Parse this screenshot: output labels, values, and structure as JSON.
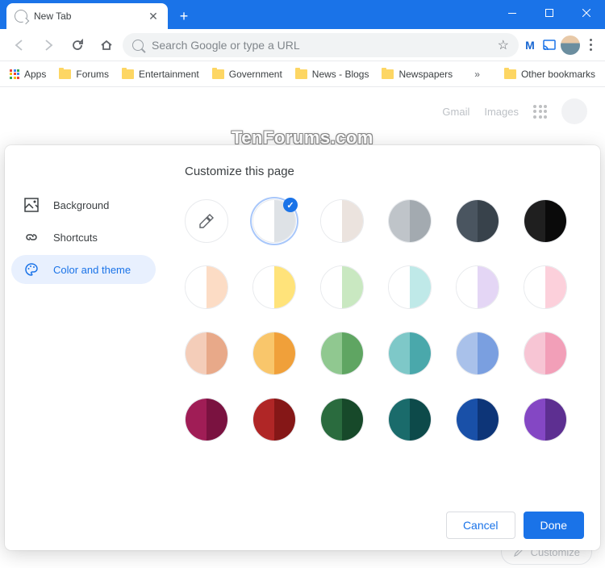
{
  "watermark": "TenForums.com",
  "tab": {
    "title": "New Tab"
  },
  "omnibox": {
    "placeholder": "Search Google or type a URL"
  },
  "bookmarks": {
    "apps": "Apps",
    "items": [
      "Forums",
      "Entertainment",
      "Government",
      "News - Blogs",
      "Newspapers"
    ],
    "overflow": "»",
    "other": "Other bookmarks"
  },
  "ntp": {
    "gmail": "Gmail",
    "images": "Images"
  },
  "dialog": {
    "title": "Customize this page",
    "sidebar": {
      "background": "Background",
      "shortcuts": "Shortcuts",
      "colortheme": "Color and theme"
    },
    "buttons": {
      "cancel": "Cancel",
      "done": "Done"
    }
  },
  "customize_btn": "Customize",
  "swatches": [
    {
      "type": "picker"
    },
    {
      "l": "#ffffff",
      "r": "#dee2e6",
      "selected": true
    },
    {
      "l": "#ffffff",
      "r": "#ebe3de"
    },
    {
      "l": "#bfc4c9",
      "r": "#a3aab0"
    },
    {
      "l": "#4a5560",
      "r": "#38424b"
    },
    {
      "l": "#1f1f1f",
      "r": "#0a0a0a"
    },
    {
      "l": "#ffffff",
      "r": "#fcdcc5"
    },
    {
      "l": "#ffffff",
      "r": "#ffe37a"
    },
    {
      "l": "#ffffff",
      "r": "#c9e8c1"
    },
    {
      "l": "#ffffff",
      "r": "#bfe9e8"
    },
    {
      "l": "#ffffff",
      "r": "#e4d6f5"
    },
    {
      "l": "#ffffff",
      "r": "#fcd0db"
    },
    {
      "l": "#f4cdb9",
      "r": "#e8a989"
    },
    {
      "l": "#f9c66b",
      "r": "#f0a03a"
    },
    {
      "l": "#90c890",
      "r": "#5fa562"
    },
    {
      "l": "#7ec8c8",
      "r": "#4aa8ab"
    },
    {
      "l": "#a9c1ea",
      "r": "#7a9fe0"
    },
    {
      "l": "#f7c5d4",
      "r": "#f29fb8"
    },
    {
      "l": "#a01d56",
      "r": "#7a1240"
    },
    {
      "l": "#b02626",
      "r": "#851717"
    },
    {
      "l": "#2a6b3e",
      "r": "#17492a"
    },
    {
      "l": "#1a6b6b",
      "r": "#0d4a4a"
    },
    {
      "l": "#1950a8",
      "r": "#0d3578"
    },
    {
      "l": "#8447c4",
      "r": "#5d2f91"
    }
  ]
}
